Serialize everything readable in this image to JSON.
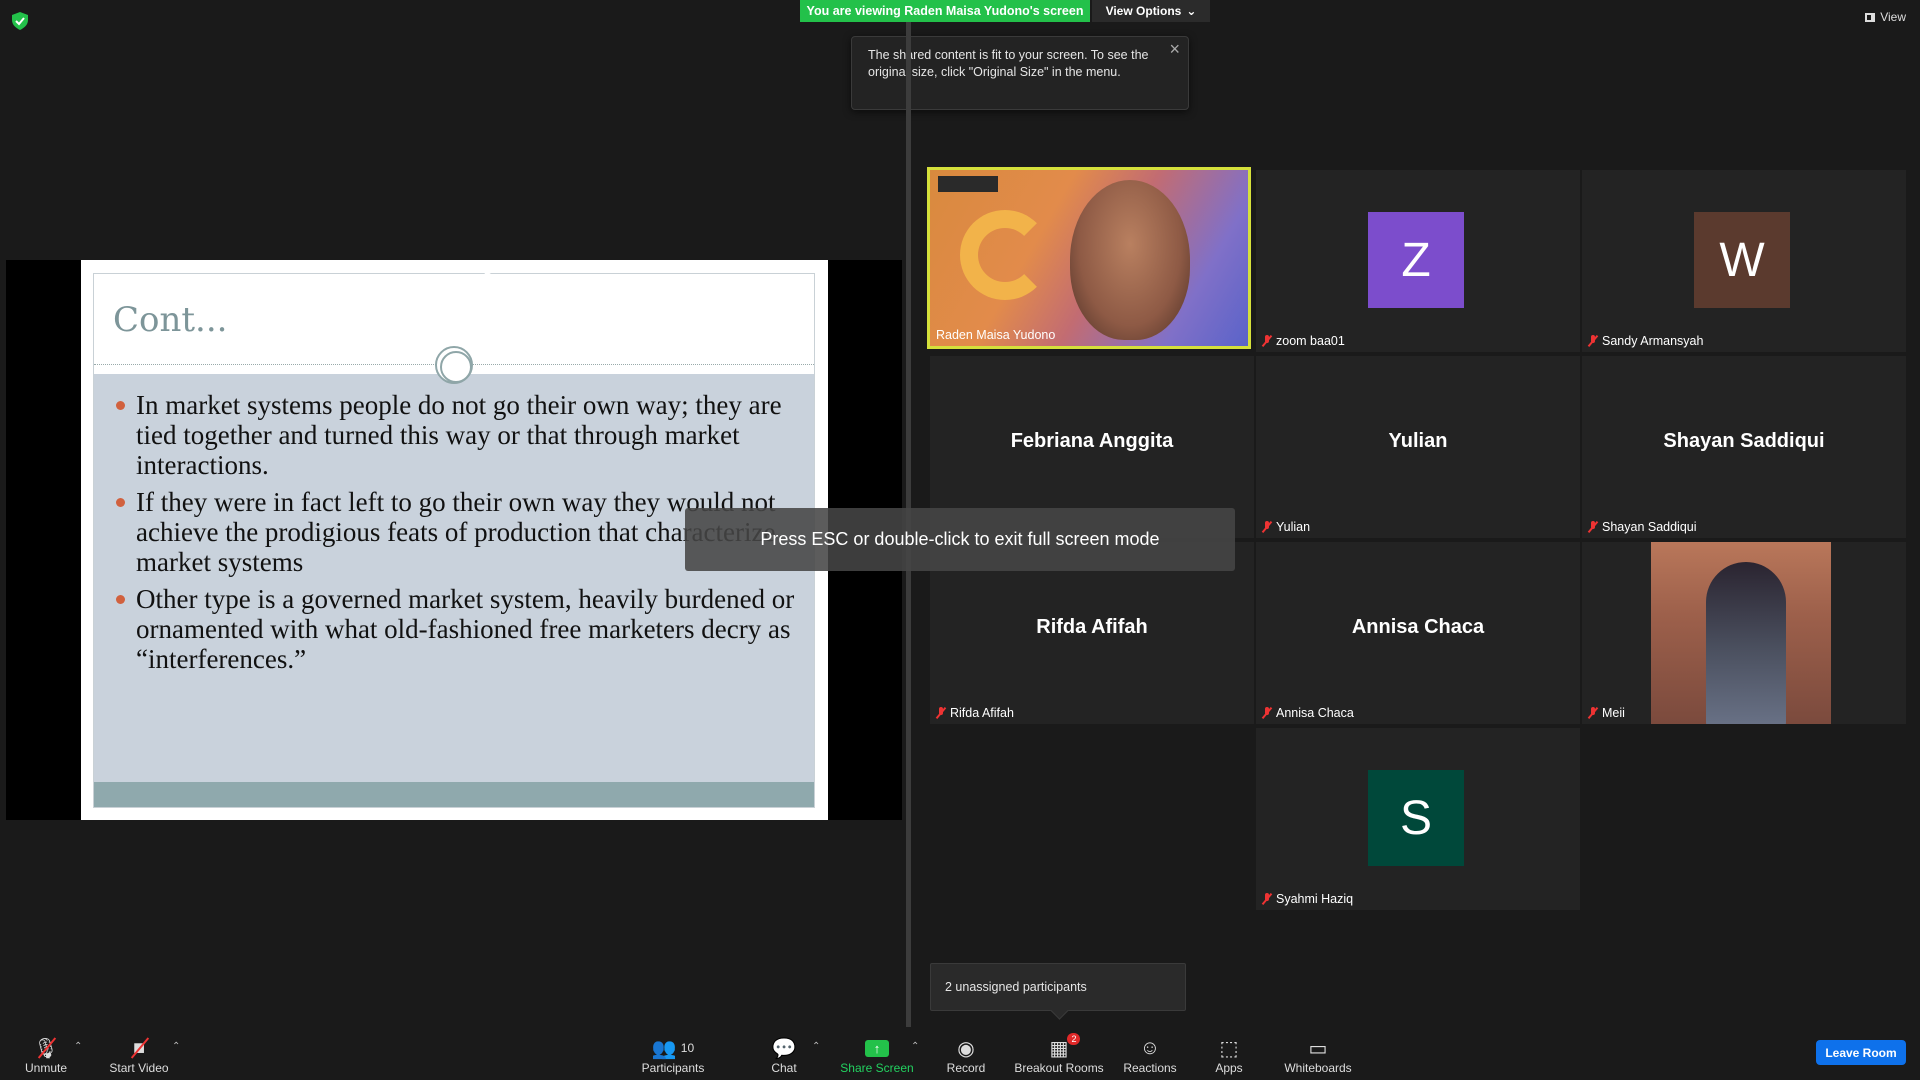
{
  "top": {
    "share_banner": "You are viewing Raden Maisa Yudono's screen",
    "view_options": "View Options",
    "view_label": "View"
  },
  "tooltip": {
    "text": "The shared content is fit to your screen. To see the original size, click \"Original Size\" in the menu."
  },
  "slide": {
    "title": "Cont...",
    "bullets": [
      "In market systems people do not go their own way; they are tied together and turned this way or that through market interactions.",
      "If they were in fact left to go their own way they would not achieve the prodigious feats of production that characterize market systems",
      "Other type is a governed market system, heavily burdened or ornamented with what old-fashioned free marketers decry as “interferences.”"
    ]
  },
  "esc_message": "Press ESC or double-click to exit full screen mode",
  "participants": [
    {
      "name": "Raden Maisa Yudono"
    },
    {
      "name": "zoom baa01",
      "initial": "Z",
      "color": "#7c4dcc"
    },
    {
      "name": "Sandy Armansyah",
      "initial": "W",
      "color": "#5b3a2e"
    },
    {
      "name": "Febriana Anggita"
    },
    {
      "name": "Yulian"
    },
    {
      "name": "Shayan Saddiqui"
    },
    {
      "name": "Rifda Afifah"
    },
    {
      "name": "Annisa Chaca"
    },
    {
      "name": "Meii"
    },
    {
      "name": "Syahmi Haziq",
      "initial": "S",
      "color": "#00483a"
    }
  ],
  "unassigned": "2 unassigned participants",
  "toolbar": {
    "unmute": "Unmute",
    "start_video": "Start Video",
    "participants": "Participants",
    "participants_count": "10",
    "chat": "Chat",
    "share_screen": "Share Screen",
    "record": "Record",
    "breakout_rooms": "Breakout Rooms",
    "breakout_badge": "2",
    "reactions": "Reactions",
    "apps": "Apps",
    "whiteboards": "Whiteboards",
    "leave_room": "Leave Room"
  }
}
